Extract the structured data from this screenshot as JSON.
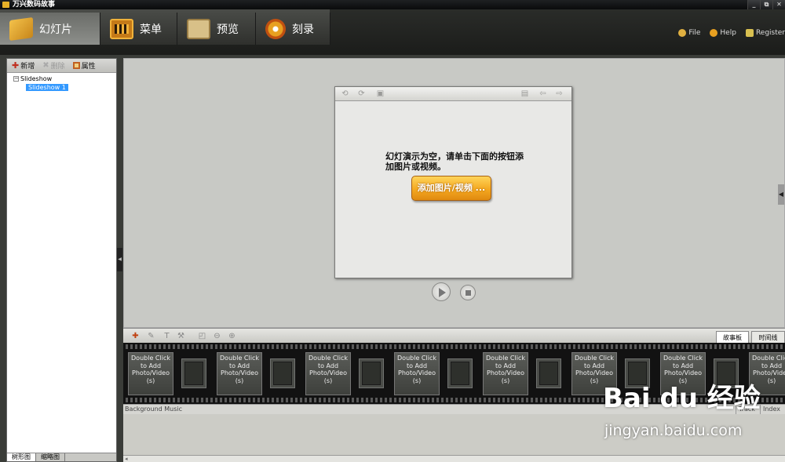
{
  "window": {
    "title": "万兴数码故事",
    "controls": [
      "_",
      "⧉",
      "✕"
    ]
  },
  "main_tabs": [
    {
      "label": "幻灯片",
      "icon": "slideshow-icon",
      "active": true
    },
    {
      "label": "菜单",
      "icon": "menu-icon",
      "active": false
    },
    {
      "label": "预览",
      "icon": "preview-icon",
      "active": false
    },
    {
      "label": "刻录",
      "icon": "burn-disc-icon",
      "active": false
    }
  ],
  "top_links": [
    {
      "label": "File",
      "icon": "file-icon",
      "color": "#e0b040"
    },
    {
      "label": "Help",
      "icon": "help-icon",
      "color": "#e8a020"
    },
    {
      "label": "Register",
      "icon": "register-key-icon",
      "color": "#d8c050"
    }
  ],
  "left_panel": {
    "tools": [
      {
        "label": "新增",
        "icon": "add-icon",
        "enabled": true
      },
      {
        "label": "删除",
        "icon": "delete-icon",
        "enabled": false
      },
      {
        "label": "属性",
        "icon": "properties-icon",
        "enabled": true
      }
    ],
    "tree": {
      "root": "Slideshow",
      "children": [
        "Slideshow 1"
      ],
      "selected": "Slideshow 1"
    },
    "bottom_tabs": [
      "树形图",
      "缩略图"
    ]
  },
  "preview": {
    "empty_message": "幻灯演示为空，请单击下面的按钮添加图片或视频。",
    "add_button": "添加图片/视频 ..."
  },
  "storyboard": {
    "view_tabs": [
      {
        "label": "故事板",
        "active": true
      },
      {
        "label": "时间线",
        "active": false
      }
    ],
    "slot_text": "Double Click to Add Photo/Video (s)",
    "slot_count": 8,
    "bg_music_columns": [
      "Background Music",
      "Track",
      "Index"
    ]
  },
  "watermark": {
    "logo": "Bai du 经验",
    "url": "jingyan.baidu.com"
  },
  "colors": {
    "accent": "#f4a820",
    "selection": "#3399ff",
    "header_bg": "#2a2c29"
  }
}
